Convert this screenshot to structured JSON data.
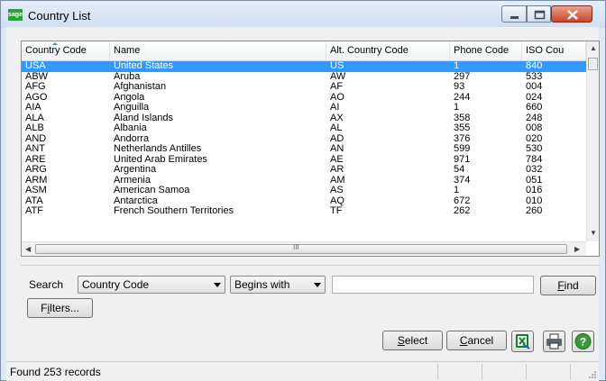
{
  "window": {
    "app_icon_text": "sage",
    "title": "Country List"
  },
  "table": {
    "columns": [
      "Country Code",
      "Name",
      "Alt. Country Code",
      "Phone Code",
      "ISO Cou"
    ],
    "rows": [
      {
        "code": "USA",
        "name": "United States",
        "alt": "US",
        "phone": "1",
        "iso": "840",
        "selected": true
      },
      {
        "code": "ABW",
        "name": "Aruba",
        "alt": "AW",
        "phone": "297",
        "iso": "533"
      },
      {
        "code": "AFG",
        "name": "Afghanistan",
        "alt": "AF",
        "phone": "93",
        "iso": "004"
      },
      {
        "code": "AGO",
        "name": "Angola",
        "alt": "AO",
        "phone": "244",
        "iso": "024"
      },
      {
        "code": "AIA",
        "name": "Anguilla",
        "alt": "AI",
        "phone": "1",
        "iso": "660"
      },
      {
        "code": "ALA",
        "name": "Åland Islands",
        "alt": "AX",
        "phone": "358",
        "iso": "248"
      },
      {
        "code": "ALB",
        "name": "Albania",
        "alt": "AL",
        "phone": "355",
        "iso": "008"
      },
      {
        "code": "AND",
        "name": "Andorra",
        "alt": "AD",
        "phone": "376",
        "iso": "020"
      },
      {
        "code": "ANT",
        "name": "Netherlands Antilles",
        "alt": "AN",
        "phone": "599",
        "iso": "530"
      },
      {
        "code": "ARE",
        "name": "United Arab Emirates",
        "alt": "AE",
        "phone": "971",
        "iso": "784"
      },
      {
        "code": "ARG",
        "name": "Argentina",
        "alt": "AR",
        "phone": "54",
        "iso": "032"
      },
      {
        "code": "ARM",
        "name": "Armenia",
        "alt": "AM",
        "phone": "374",
        "iso": "051"
      },
      {
        "code": "ASM",
        "name": "American Samoa",
        "alt": "AS",
        "phone": "1",
        "iso": "016"
      },
      {
        "code": "ATA",
        "name": "Antarctica",
        "alt": "AQ",
        "phone": "672",
        "iso": "010"
      },
      {
        "code": "ATF",
        "name": "French Southern Territories",
        "alt": "TF",
        "phone": "262",
        "iso": "260"
      }
    ],
    "hscroll_thumb_grip": "III"
  },
  "search": {
    "label": "Search",
    "field_value": "Country Code",
    "operator_value": "Begins with",
    "text_value": "",
    "find_label": "Find",
    "filters_label": "Filters..."
  },
  "actions": {
    "select_label": "Select",
    "cancel_label": "Cancel",
    "icons": [
      "excel-export-icon",
      "printer-icon",
      "help-icon"
    ]
  },
  "status": {
    "text": "Found 253 records"
  },
  "colors": {
    "selection": "#3399ff",
    "excel_green": "#1e7b34",
    "help_green": "#3a9a3a",
    "close_red": "#c9472a"
  }
}
